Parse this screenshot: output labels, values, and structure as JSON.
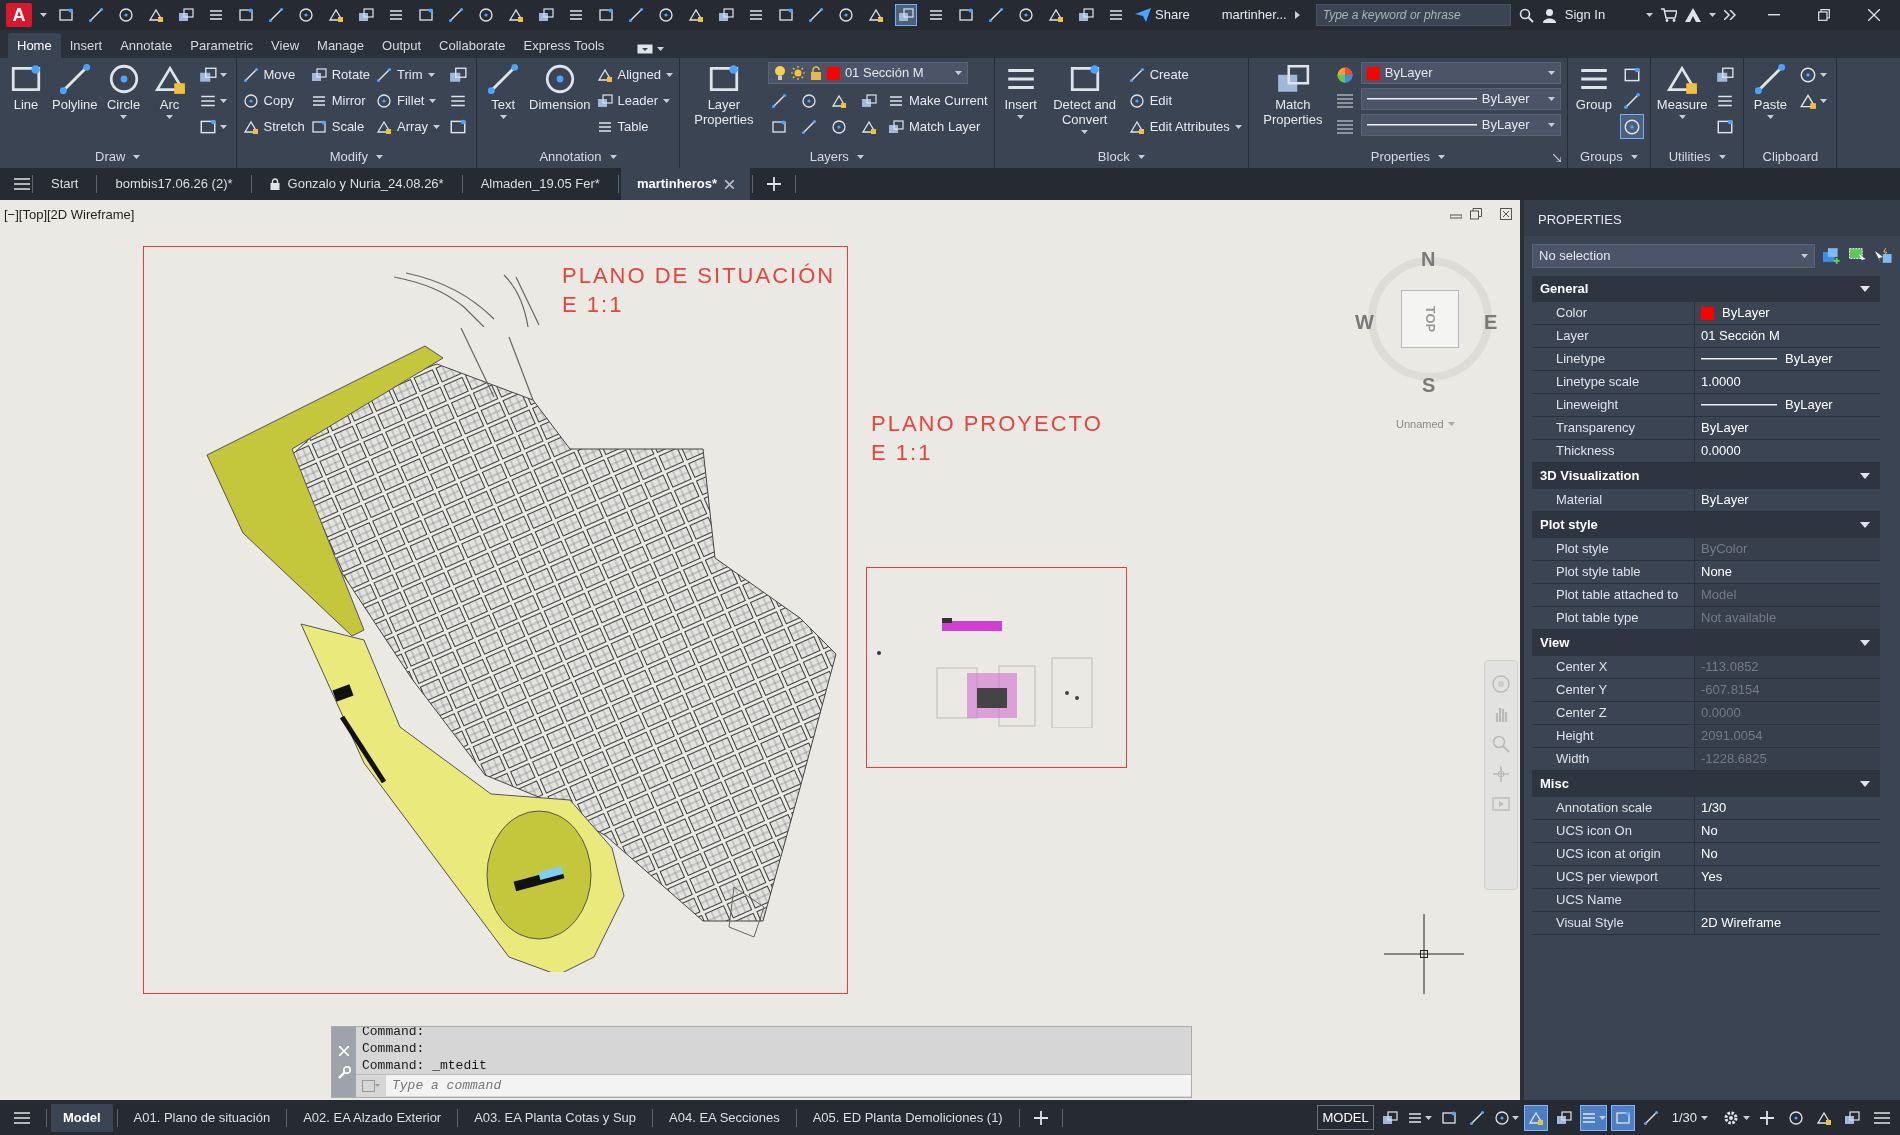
{
  "title_bar": {
    "logo": "A",
    "quick_access": [
      {
        "on": false
      },
      {
        "on": false
      },
      {
        "on": false
      },
      {
        "on": false
      },
      {
        "on": false
      },
      {
        "on": false
      },
      {
        "on": false
      },
      {
        "on": false
      },
      {
        "on": false
      },
      {
        "on": false
      },
      {
        "on": false
      },
      {
        "on": false
      },
      {
        "on": false
      },
      {
        "on": false
      },
      {
        "on": false
      },
      {
        "on": false
      },
      {
        "on": false
      },
      {
        "on": false
      },
      {
        "on": false
      },
      {
        "on": false
      },
      {
        "on": false
      },
      {
        "on": false
      },
      {
        "on": false
      },
      {
        "on": false
      },
      {
        "on": false
      },
      {
        "on": false
      },
      {
        "on": false
      },
      {
        "on": false
      },
      {
        "on": true
      },
      {
        "on": false
      },
      {
        "on": false
      },
      {
        "on": false
      },
      {
        "on": false
      },
      {
        "on": false
      },
      {
        "on": false
      },
      {
        "on": false
      }
    ],
    "share": "Share",
    "document": "martinher...",
    "search": {
      "placeholder": "Type a keyword or phrase"
    },
    "sign_in": "Sign In"
  },
  "ribbon_tabs": [
    {
      "label": "Home",
      "selected": true
    },
    {
      "label": "Insert",
      "selected": false
    },
    {
      "label": "Annotate",
      "selected": false
    },
    {
      "label": "Parametric",
      "selected": false
    },
    {
      "label": "View",
      "selected": false
    },
    {
      "label": "Manage",
      "selected": false
    },
    {
      "label": "Output",
      "selected": false
    },
    {
      "label": "Collaborate",
      "selected": false
    },
    {
      "label": "Express Tools",
      "selected": false
    }
  ],
  "ribbon_panels": [
    {
      "title": "Draw",
      "dropdown": true,
      "launcher": false,
      "columns": [
        [
          {
            "kind": "large",
            "label": "Line",
            "dropdown": false
          }
        ],
        [
          {
            "kind": "large",
            "label": "Polyline",
            "dropdown": false
          }
        ],
        [
          {
            "kind": "large",
            "label": "Circle",
            "dropdown": true
          }
        ],
        [
          {
            "kind": "large",
            "label": "Arc",
            "dropdown": true
          }
        ],
        [
          {
            "kind": "icon",
            "dropdown": true,
            "on": false
          },
          {
            "kind": "icon",
            "dropdown": true,
            "on": false
          },
          {
            "kind": "icon",
            "dropdown": true,
            "on": false
          }
        ]
      ]
    },
    {
      "title": "Modify",
      "dropdown": true,
      "launcher": false,
      "columns": [
        [
          {
            "kind": "small",
            "label": "Move",
            "dropdown": false
          },
          {
            "kind": "small",
            "label": "Copy",
            "dropdown": false
          },
          {
            "kind": "small",
            "label": "Stretch",
            "dropdown": false
          }
        ],
        [
          {
            "kind": "small",
            "label": "Rotate",
            "dropdown": false
          },
          {
            "kind": "small",
            "label": "Mirror",
            "dropdown": false
          },
          {
            "kind": "small",
            "label": "Scale",
            "dropdown": false
          }
        ],
        [
          {
            "kind": "small",
            "label": "Trim",
            "dropdown": true
          },
          {
            "kind": "small",
            "label": "Fillet",
            "dropdown": true
          },
          {
            "kind": "small",
            "label": "Array",
            "dropdown": true
          }
        ],
        [
          {
            "kind": "icon",
            "dropdown": false,
            "on": false
          },
          {
            "kind": "icon",
            "dropdown": false,
            "on": false
          },
          {
            "kind": "icon",
            "dropdown": false,
            "on": false
          }
        ]
      ]
    },
    {
      "title": "Annotation",
      "dropdown": true,
      "launcher": false,
      "columns": [
        [
          {
            "kind": "large",
            "label": "Text",
            "dropdown": true
          }
        ],
        [
          {
            "kind": "large",
            "label": "Dimension",
            "dropdown": false
          }
        ],
        [
          {
            "kind": "small",
            "label": "Aligned",
            "dropdown": true
          },
          {
            "kind": "small",
            "label": "Leader",
            "dropdown": true
          },
          {
            "kind": "small",
            "label": "Table",
            "dropdown": false
          }
        ]
      ]
    },
    {
      "title": "Layers",
      "dropdown": true,
      "launcher": false,
      "columns": [
        [
          {
            "kind": "large",
            "label": "Layer Properties",
            "dropdown": false
          }
        ],
        [
          {
            "kind": "layer_combo",
            "label": "01 Sección M",
            "color": "#ff0000",
            "dropdown": true
          },
          {
            "kind": "small_row",
            "label": "Make Current",
            "dropdown": false
          },
          {
            "kind": "small_row",
            "label": "Match Layer",
            "dropdown": false
          }
        ]
      ]
    },
    {
      "title": "Block",
      "dropdown": true,
      "launcher": false,
      "columns": [
        [
          {
            "kind": "large",
            "label": "Insert",
            "dropdown": true
          }
        ],
        [
          {
            "kind": "large",
            "label": "Detect and Convert",
            "dropdown": true
          }
        ],
        [
          {
            "kind": "small",
            "label": "Create",
            "dropdown": false
          },
          {
            "kind": "small",
            "label": "Edit",
            "dropdown": false
          },
          {
            "kind": "small",
            "label": "Edit Attributes",
            "dropdown": true
          }
        ]
      ]
    },
    {
      "title": "Properties",
      "dropdown": true,
      "launcher": true,
      "columns": [
        [
          {
            "kind": "large",
            "label": "Match Properties",
            "dropdown": false
          }
        ],
        [
          {
            "kind": "color_combo",
            "label": "ByLayer",
            "color": "#ff0000",
            "dropdown": true
          },
          {
            "kind": "line_combo",
            "label": "ByLayer",
            "dropdown": true
          },
          {
            "kind": "line_combo",
            "label": "ByLayer",
            "dropdown": true
          }
        ]
      ]
    },
    {
      "title": "Groups",
      "dropdown": true,
      "launcher": false,
      "columns": [
        [
          {
            "kind": "large",
            "label": "Group",
            "dropdown": false
          }
        ],
        [
          {
            "kind": "icon",
            "dropdown": false,
            "on": false
          },
          {
            "kind": "icon",
            "dropdown": false,
            "on": false
          },
          {
            "kind": "icon",
            "dropdown": false,
            "on": true
          }
        ]
      ]
    },
    {
      "title": "Utilities",
      "dropdown": true,
      "launcher": false,
      "columns": [
        [
          {
            "kind": "large",
            "label": "Measure",
            "dropdown": true
          }
        ],
        [
          {
            "kind": "icon",
            "dropdown": false,
            "on": false
          },
          {
            "kind": "icon",
            "dropdown": false,
            "on": false
          },
          {
            "kind": "icon",
            "dropdown": false,
            "on": false
          }
        ]
      ]
    },
    {
      "title": "Clipboard",
      "dropdown": false,
      "launcher": false,
      "columns": [
        [
          {
            "kind": "large",
            "label": "Paste",
            "dropdown": true
          }
        ],
        [
          {
            "kind": "icon",
            "dropdown": true,
            "on": false
          },
          {
            "kind": "icon",
            "dropdown": true,
            "on": false
          }
        ]
      ]
    }
  ],
  "file_tabs": [
    {
      "label": "Start",
      "selected": false,
      "locked": false
    },
    {
      "label": "bombis17.06.26 (2)*",
      "selected": false,
      "locked": false
    },
    {
      "label": "Gonzalo y Nuria_24.08.26*",
      "selected": false,
      "locked": true
    },
    {
      "label": "Almaden_19.05 Fer*",
      "selected": false,
      "locked": false
    },
    {
      "label": "martinheros*",
      "selected": true,
      "locked": false
    }
  ],
  "viewport": {
    "label": "[−][Top][2D Wireframe]",
    "sheets": [
      {
        "title": "PLANO DE SITUACIÓN",
        "scale": "E 1:1"
      },
      {
        "title": "PLANO PROYECTO",
        "scale": "E 1:1"
      }
    ],
    "view_cube": {
      "north": "N",
      "south": "S",
      "east": "E",
      "west": "W",
      "face": "TOP",
      "view_name": "Unnamed"
    },
    "command_line": {
      "history": [
        "Command:",
        "Command:",
        "Command: _mtedit"
      ],
      "placeholder": "Type a command"
    }
  },
  "properties_palette": {
    "title": "PROPERTIES",
    "selection": "No selection",
    "sections": [
      {
        "title": "General",
        "expanded": true,
        "rows": [
          {
            "label": "Color",
            "value": "ByLayer",
            "kind": "color",
            "color": "#ff0000",
            "disabled": false
          },
          {
            "label": "Layer",
            "value": "01 Sección M",
            "kind": "text",
            "disabled": false
          },
          {
            "label": "Linetype",
            "value": "ByLayer",
            "kind": "line",
            "disabled": false
          },
          {
            "label": "Linetype scale",
            "value": "1.0000",
            "kind": "text",
            "disabled": false
          },
          {
            "label": "Lineweight",
            "value": "ByLayer",
            "kind": "line",
            "disabled": false
          },
          {
            "label": "Transparency",
            "value": "ByLayer",
            "kind": "text",
            "disabled": false
          },
          {
            "label": "Thickness",
            "value": "0.0000",
            "kind": "text",
            "disabled": false
          }
        ]
      },
      {
        "title": "3D Visualization",
        "expanded": true,
        "rows": [
          {
            "label": "Material",
            "value": "ByLayer",
            "kind": "text",
            "disabled": false
          }
        ]
      },
      {
        "title": "Plot style",
        "expanded": true,
        "rows": [
          {
            "label": "Plot style",
            "value": "ByColor",
            "kind": "text",
            "disabled": true
          },
          {
            "label": "Plot style table",
            "value": "None",
            "kind": "text",
            "disabled": false
          },
          {
            "label": "Plot table attached to",
            "value": "Model",
            "kind": "text",
            "disabled": true
          },
          {
            "label": "Plot table type",
            "value": "Not available",
            "kind": "text",
            "disabled": true
          }
        ]
      },
      {
        "title": "View",
        "expanded": true,
        "rows": [
          {
            "label": "Center X",
            "value": "-113.0852",
            "kind": "text",
            "disabled": true
          },
          {
            "label": "Center Y",
            "value": "-607.8154",
            "kind": "text",
            "disabled": true
          },
          {
            "label": "Center Z",
            "value": "0.0000",
            "kind": "text",
            "disabled": true
          },
          {
            "label": "Height",
            "value": "2091.0054",
            "kind": "text",
            "disabled": true
          },
          {
            "label": "Width",
            "value": "-1228.6825",
            "kind": "text",
            "disabled": true
          }
        ]
      },
      {
        "title": "Misc",
        "expanded": true,
        "rows": [
          {
            "label": "Annotation scale",
            "value": "1/30",
            "kind": "text",
            "disabled": false
          },
          {
            "label": "UCS icon On",
            "value": "No",
            "kind": "text",
            "disabled": false
          },
          {
            "label": "UCS icon at origin",
            "value": "No",
            "kind": "text",
            "disabled": false
          },
          {
            "label": "UCS per viewport",
            "value": "Yes",
            "kind": "text",
            "disabled": false
          },
          {
            "label": "UCS Name",
            "kind": "text",
            "disabled": false
          },
          {
            "label": "Visual Style",
            "value": "2D Wireframe",
            "kind": "text",
            "disabled": false
          }
        ]
      }
    ]
  },
  "layout_tabs": [
    {
      "label": "Model",
      "selected": true
    },
    {
      "label": "A01. Plano de situación",
      "selected": false
    },
    {
      "label": "A02. EA Alzado Exterior",
      "selected": false
    },
    {
      "label": "A03. EA Planta Cotas y Sup",
      "selected": false
    },
    {
      "label": "A04. EA Secciones",
      "selected": false
    },
    {
      "label": "A05. ED Planta Demoliciones (1)",
      "selected": false
    }
  ],
  "status_bar": {
    "space": "MODEL",
    "annotation_scale": "1/30",
    "toggles": [
      {
        "on": false
      },
      {
        "on": false
      },
      {
        "on": false
      },
      {
        "on": false
      },
      {
        "on": false
      },
      {
        "on": true
      },
      {
        "on": false
      },
      {
        "on": true
      },
      {
        "on": true
      },
      {
        "on": false
      }
    ]
  }
}
